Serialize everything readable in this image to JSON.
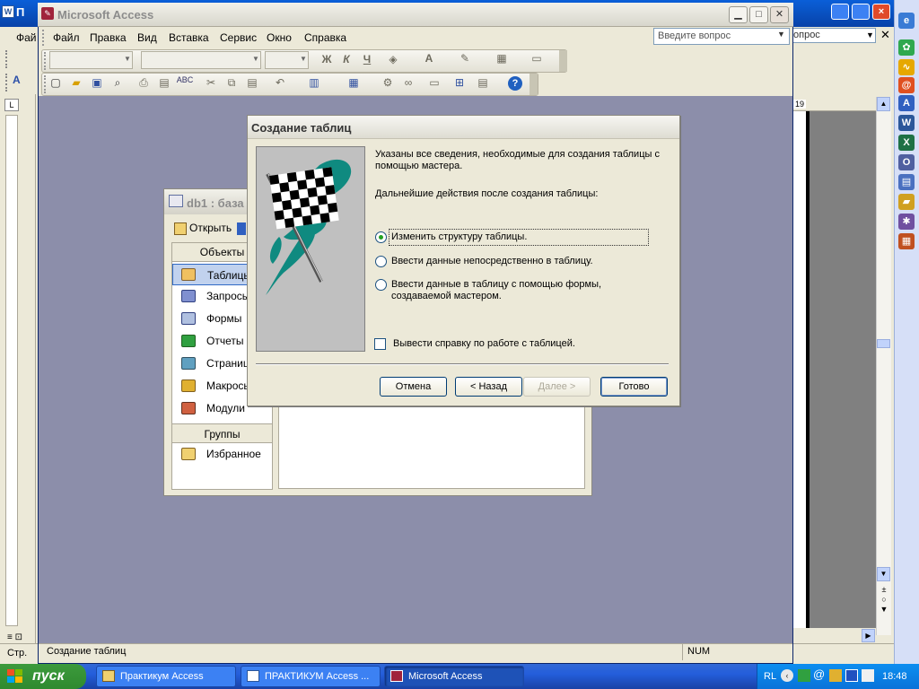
{
  "background_word": {
    "title_fragment": "П",
    "menu_file_fragment": "Фай",
    "ask_fragment": "опрос",
    "status_page": "Стр.",
    "ruler_box_number": "19"
  },
  "access": {
    "title": "Microsoft Access",
    "menu": [
      "Файл",
      "Правка",
      "Вид",
      "Вставка",
      "Сервис",
      "Окно",
      "Справка"
    ],
    "ask_placeholder": "Введите вопрос",
    "format_glyphs": [
      "Ж",
      "К",
      "Ч"
    ],
    "status_text": "Создание таблиц",
    "status_num": "NUM"
  },
  "db_window": {
    "title": "db1 : база",
    "open_label": "Открыть",
    "objects_header": "Объекты",
    "nav_items": [
      "Таблицы",
      "Запросы",
      "Формы",
      "Отчеты",
      "Страницы",
      "Макросы",
      "Модули"
    ],
    "groups_header": "Группы",
    "favorites": "Избранное"
  },
  "wizard": {
    "title": "Создание таблиц",
    "info_line1": "Указаны все сведения, необходимые для создания таблицы с",
    "info_line2": "помощью мастера.",
    "next_actions": "Дальнейшие действия после создания таблицы:",
    "option1": "Изменить структуру таблицы.",
    "option2": "Ввести данные непосредственно в таблицу.",
    "option3_line1": "Ввести данные в таблицу с помощью формы,",
    "option3_line2": "создаваемой мастером.",
    "checkbox_label": "Вывести справку по работе с таблицей.",
    "btn_cancel": "Отмена",
    "btn_back": "< Назад",
    "btn_next": "Далее >",
    "btn_finish": "Готово"
  },
  "taskbar": {
    "start": "пуск",
    "tasks": [
      "Практикум Access",
      "ПРАКТИКУМ Access ...",
      "Microsoft Access"
    ],
    "lang": "RL",
    "clock": "18:48"
  }
}
